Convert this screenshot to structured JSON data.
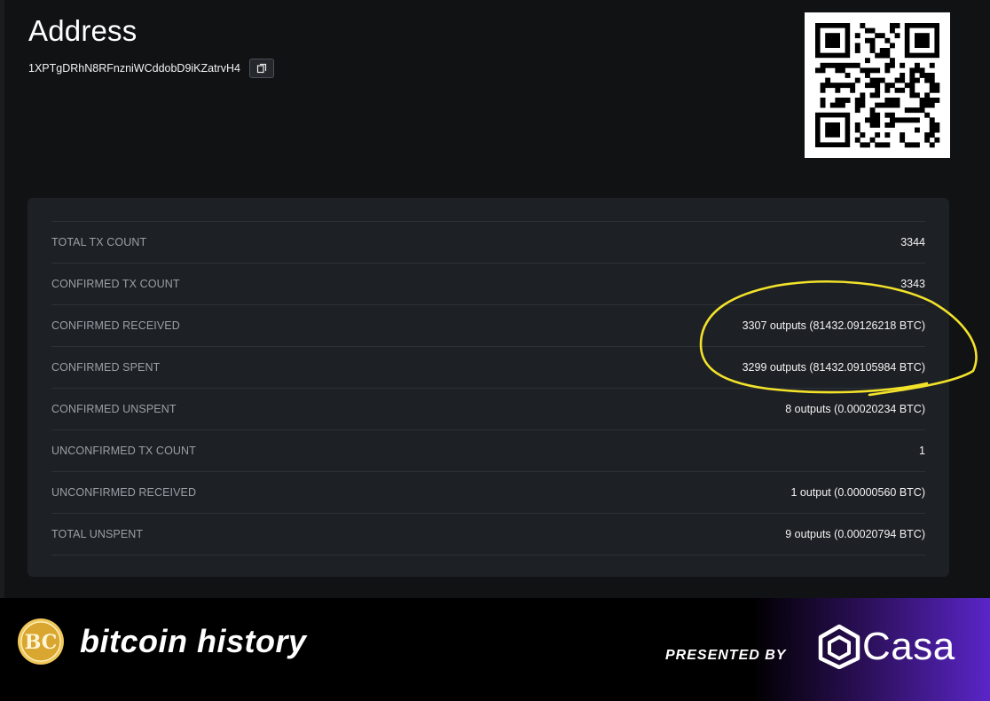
{
  "header": {
    "title": "Address",
    "address": "1XPTgDRhN8RFnzniWCddobD9iKZatrvH4",
    "copy_icon": "copy-icon",
    "qr_icon": "qr-code"
  },
  "stats": [
    {
      "label": "TOTAL TX COUNT",
      "value": "3344"
    },
    {
      "label": "CONFIRMED TX COUNT",
      "value": "3343"
    },
    {
      "label": "CONFIRMED RECEIVED",
      "value": "3307 outputs (81432.09126218 BTC)"
    },
    {
      "label": "CONFIRMED SPENT",
      "value": "3299 outputs (81432.09105984 BTC)"
    },
    {
      "label": "CONFIRMED UNSPENT",
      "value": "8 outputs (0.00020234 BTC)"
    },
    {
      "label": "UNCONFIRMED TX COUNT",
      "value": "1"
    },
    {
      "label": "UNCONFIRMED RECEIVED",
      "value": "1 output (0.00000560 BTC)"
    },
    {
      "label": "TOTAL UNSPENT",
      "value": "9 outputs (0.00020794 BTC)"
    }
  ],
  "annotation_color": "#f2e22a",
  "footer": {
    "logo_text": "BC",
    "brand": "bitcoin history",
    "presented_by": "PRESENTED BY",
    "sponsor": "Casa",
    "logo_color": "#d9a730"
  }
}
